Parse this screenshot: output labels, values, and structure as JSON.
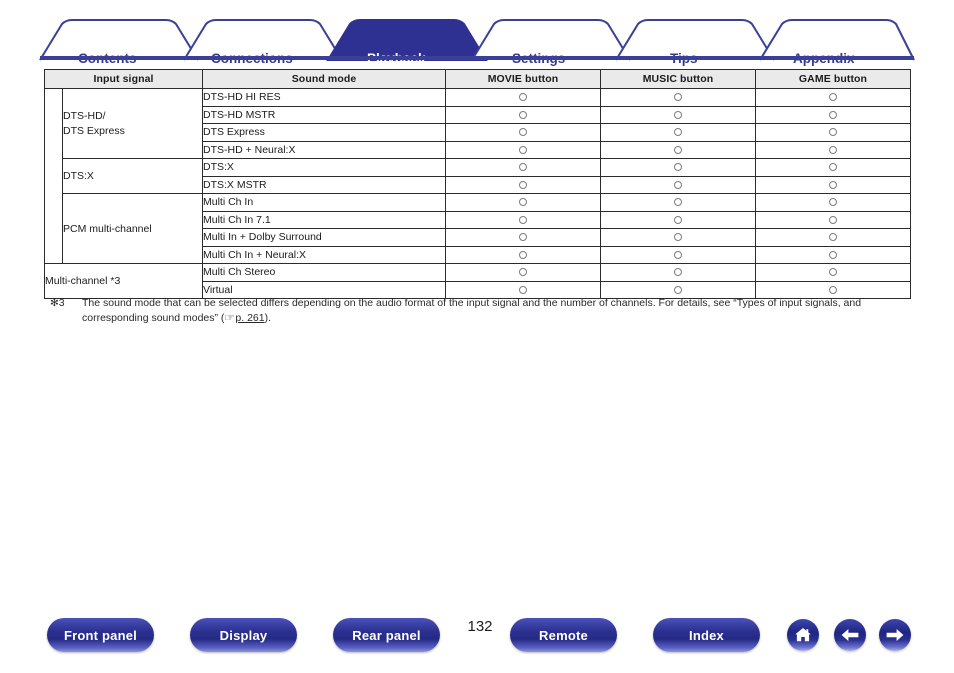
{
  "tabs": [
    {
      "label": "Contents",
      "active": false
    },
    {
      "label": "Connections",
      "active": false
    },
    {
      "label": "Playback",
      "active": true
    },
    {
      "label": "Settings",
      "active": false
    },
    {
      "label": "Tips",
      "active": false
    },
    {
      "label": "Appendix",
      "active": false
    }
  ],
  "table": {
    "headers": [
      "Input signal",
      "Sound mode",
      "MOVIE button",
      "MUSIC button",
      "GAME button"
    ],
    "supergroup": "Multi-channel *3",
    "groups": [
      {
        "name": "DTS-HD/\nDTS Express",
        "name_lines": [
          "DTS-HD/",
          "DTS Express"
        ],
        "rows": [
          {
            "mode": "DTS-HD HI RES",
            "movie": "circle",
            "music": "circle",
            "game": "circle"
          },
          {
            "mode": "DTS-HD MSTR",
            "movie": "circle",
            "music": "circle",
            "game": "circle"
          },
          {
            "mode": "DTS Express",
            "movie": "circle",
            "music": "circle",
            "game": "circle"
          },
          {
            "mode": "DTS-HD + Neural:X",
            "movie": "circle",
            "music": "circle",
            "game": "circle"
          }
        ]
      },
      {
        "name": "DTS:X",
        "name_lines": [
          "DTS:X"
        ],
        "rows": [
          {
            "mode": "DTS:X",
            "movie": "circle",
            "music": "circle",
            "game": "circle"
          },
          {
            "mode": "DTS:X MSTR",
            "movie": "circle",
            "music": "circle",
            "game": "circle"
          }
        ]
      },
      {
        "name": "PCM multi-channel",
        "name_lines": [
          "PCM multi-channel"
        ],
        "rows": [
          {
            "mode": "Multi Ch In",
            "movie": "circle",
            "music": "circle",
            "game": "circle"
          },
          {
            "mode": "Multi Ch In 7.1",
            "movie": "circle",
            "music": "circle",
            "game": "circle"
          },
          {
            "mode": "Multi In + Dolby Surround",
            "movie": "circle",
            "music": "circle",
            "game": "circle"
          },
          {
            "mode": "Multi Ch In + Neural:X",
            "movie": "circle",
            "music": "circle",
            "game": "circle"
          }
        ]
      },
      {
        "name": "",
        "name_lines": [],
        "rows": [
          {
            "mode": "Multi Ch Stereo",
            "movie": "circle",
            "music": "circle",
            "game": "circle"
          },
          {
            "mode": "Virtual",
            "movie": "circle",
            "music": "circle",
            "game": "circle"
          }
        ]
      }
    ]
  },
  "footnote": {
    "mark": "✻3",
    "text_before": "The sound mode that can be selected differs depending on the audio format of the input signal and the number of channels. For details, see “Types of input signals, and corresponding sound modes” (",
    "link_icon": "pointing-hand-icon",
    "link_text": "p. 261",
    "text_after": ")."
  },
  "bottom_nav": {
    "page_number": "132",
    "buttons": [
      {
        "label": "Front panel",
        "name": "front-panel-button"
      },
      {
        "label": "Display",
        "name": "display-button"
      },
      {
        "label": "Rear panel",
        "name": "rear-panel-button"
      },
      {
        "label": "Remote",
        "name": "remote-button"
      },
      {
        "label": "Index",
        "name": "index-button"
      }
    ],
    "icon_buttons": [
      {
        "name": "home-icon",
        "glyph": "home"
      },
      {
        "name": "arrow-left-icon",
        "glyph": "arrow-left"
      },
      {
        "name": "arrow-right-icon",
        "glyph": "arrow-right"
      }
    ]
  },
  "colors": {
    "brand_blue": "#2e3192",
    "tab_outline": "#3b3f97",
    "active_tab_bg": "#2e3192",
    "header_bg": "#eaeaea",
    "border": "#2b2b2b"
  }
}
